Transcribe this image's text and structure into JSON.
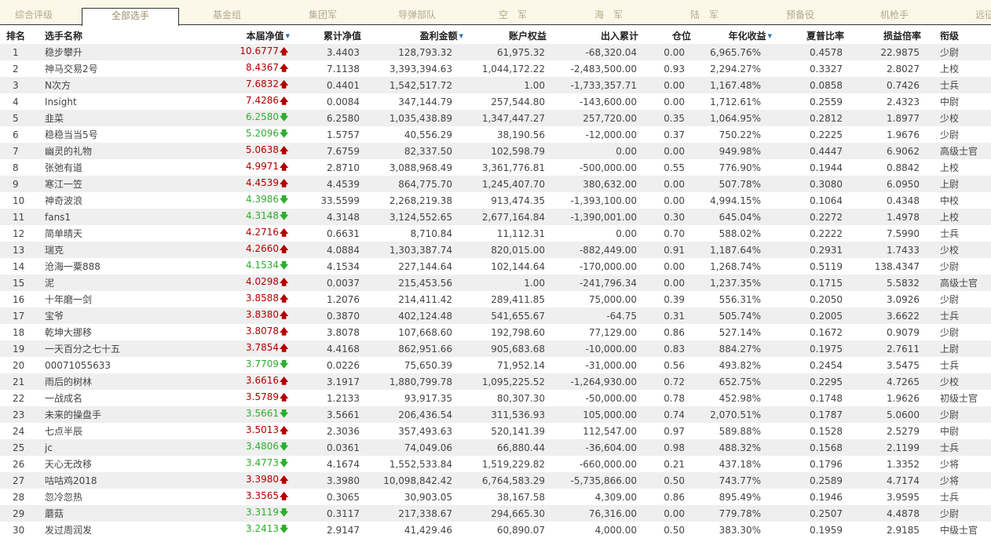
{
  "tabs": [
    {
      "label": "综合评级",
      "active": false
    },
    {
      "label": "全部选手",
      "active": true
    },
    {
      "label": "基金组",
      "active": false
    },
    {
      "label": "集团军",
      "active": false
    },
    {
      "label": "导弹部队",
      "active": false
    },
    {
      "label": "空　军",
      "active": false
    },
    {
      "label": "海　军",
      "active": false
    },
    {
      "label": "陆　军",
      "active": false
    },
    {
      "label": "预备役",
      "active": false
    },
    {
      "label": "机枪手",
      "active": false
    },
    {
      "label": "远征",
      "active": false
    }
  ],
  "columns": [
    {
      "label": "排名",
      "sortable": false
    },
    {
      "label": "选手名称",
      "sortable": false
    },
    {
      "label": "本届净值",
      "sortable": true
    },
    {
      "label": "累计净值",
      "sortable": false
    },
    {
      "label": "盈利金额",
      "sortable": true
    },
    {
      "label": "账户权益",
      "sortable": false
    },
    {
      "label": "出入累计",
      "sortable": false
    },
    {
      "label": "仓位",
      "sortable": false
    },
    {
      "label": "年化收益",
      "sortable": true
    },
    {
      "label": "夏普比率",
      "sortable": false
    },
    {
      "label": "损益倍率",
      "sortable": false
    },
    {
      "label": "衔级",
      "sortable": false
    }
  ],
  "icons": {
    "sort": "sort-down-icon",
    "up": "arrow-up-icon",
    "down": "arrow-down-icon",
    "up_glyph": "🡅",
    "down_glyph": "🡇",
    "sort_glyph": "▼"
  },
  "colors": {
    "up": "#b30000",
    "down": "#2eae2e",
    "sort": "#2a6fb8"
  },
  "rows": [
    {
      "rank": "1",
      "name": "稳步攀升",
      "nav": "10.6777",
      "trend": "up",
      "cum_nav": "3.4403",
      "profit": "128,793.32",
      "equity": "61,975.32",
      "flow": "-68,320.04",
      "position": "0.00",
      "annual": "6,965.76%",
      "sharpe": "0.4578",
      "pl_ratio": "22.9875",
      "grade": "少尉"
    },
    {
      "rank": "2",
      "name": "神马交易2号",
      "nav": "8.4367",
      "trend": "up",
      "cum_nav": "7.1138",
      "profit": "3,393,394.63",
      "equity": "1,044,172.22",
      "flow": "-2,483,500.00",
      "position": "0.93",
      "annual": "2,294.27%",
      "sharpe": "0.3327",
      "pl_ratio": "2.8027",
      "grade": "上校"
    },
    {
      "rank": "3",
      "name": "N次方",
      "nav": "7.6832",
      "trend": "up",
      "cum_nav": "0.4401",
      "profit": "1,542,517.72",
      "equity": "1.00",
      "flow": "-1,733,357.71",
      "position": "0.00",
      "annual": "1,167.48%",
      "sharpe": "0.0858",
      "pl_ratio": "0.7426",
      "grade": "士兵"
    },
    {
      "rank": "4",
      "name": "Insight",
      "nav": "7.4286",
      "trend": "up",
      "cum_nav": "0.0084",
      "profit": "347,144.79",
      "equity": "257,544.80",
      "flow": "-143,600.00",
      "position": "0.00",
      "annual": "1,712.61%",
      "sharpe": "0.2559",
      "pl_ratio": "2.4323",
      "grade": "中尉"
    },
    {
      "rank": "5",
      "name": "韭菜",
      "nav": "6.2580",
      "trend": "down",
      "cum_nav": "6.2580",
      "profit": "1,035,438.89",
      "equity": "1,347,447.27",
      "flow": "257,720.00",
      "position": "0.35",
      "annual": "1,064.95%",
      "sharpe": "0.2812",
      "pl_ratio": "1.8977",
      "grade": "少校"
    },
    {
      "rank": "6",
      "name": "稳稳当当5号",
      "nav": "5.2096",
      "trend": "down",
      "cum_nav": "1.5757",
      "profit": "40,556.29",
      "equity": "38,190.56",
      "flow": "-12,000.00",
      "position": "0.37",
      "annual": "750.22%",
      "sharpe": "0.2225",
      "pl_ratio": "1.9676",
      "grade": "少尉"
    },
    {
      "rank": "7",
      "name": "幽灵的礼物",
      "nav": "5.0638",
      "trend": "up",
      "cum_nav": "7.6759",
      "profit": "82,337.50",
      "equity": "102,598.79",
      "flow": "0.00",
      "position": "0.00",
      "annual": "949.98%",
      "sharpe": "0.4447",
      "pl_ratio": "6.9062",
      "grade": "高级士官"
    },
    {
      "rank": "8",
      "name": "张弛有道",
      "nav": "4.9971",
      "trend": "up",
      "cum_nav": "2.8710",
      "profit": "3,088,968.49",
      "equity": "3,361,776.81",
      "flow": "-500,000.00",
      "position": "0.55",
      "annual": "776.90%",
      "sharpe": "0.1944",
      "pl_ratio": "0.8842",
      "grade": "上校"
    },
    {
      "rank": "9",
      "name": "寒江一笠",
      "nav": "4.4539",
      "trend": "up",
      "cum_nav": "4.4539",
      "profit": "864,775.70",
      "equity": "1,245,407.70",
      "flow": "380,632.00",
      "position": "0.00",
      "annual": "507.78%",
      "sharpe": "0.3080",
      "pl_ratio": "6.0950",
      "grade": "上尉"
    },
    {
      "rank": "10",
      "name": "神奇波浪",
      "nav": "4.3986",
      "trend": "down",
      "cum_nav": "33.5599",
      "profit": "2,268,219.38",
      "equity": "913,474.35",
      "flow": "-1,393,100.00",
      "position": "0.00",
      "annual": "4,994.15%",
      "sharpe": "0.1064",
      "pl_ratio": "0.4348",
      "grade": "中校"
    },
    {
      "rank": "11",
      "name": "fans1",
      "nav": "4.3148",
      "trend": "down",
      "cum_nav": "4.3148",
      "profit": "3,124,552.65",
      "equity": "2,677,164.84",
      "flow": "-1,390,001.00",
      "position": "0.30",
      "annual": "645.04%",
      "sharpe": "0.2272",
      "pl_ratio": "1.4978",
      "grade": "上校"
    },
    {
      "rank": "12",
      "name": "简单晴天",
      "nav": "4.2716",
      "trend": "up",
      "cum_nav": "0.6631",
      "profit": "8,710.84",
      "equity": "11,112.31",
      "flow": "0.00",
      "position": "0.70",
      "annual": "588.02%",
      "sharpe": "0.2222",
      "pl_ratio": "7.5990",
      "grade": "士兵"
    },
    {
      "rank": "13",
      "name": "瑞克",
      "nav": "4.2660",
      "trend": "up",
      "cum_nav": "4.0884",
      "profit": "1,303,387.74",
      "equity": "820,015.00",
      "flow": "-882,449.00",
      "position": "0.91",
      "annual": "1,187.64%",
      "sharpe": "0.2931",
      "pl_ratio": "1.7433",
      "grade": "少校"
    },
    {
      "rank": "14",
      "name": "沧海一粟888",
      "nav": "4.1534",
      "trend": "down",
      "cum_nav": "4.1534",
      "profit": "227,144.64",
      "equity": "102,144.64",
      "flow": "-170,000.00",
      "position": "0.00",
      "annual": "1,268.74%",
      "sharpe": "0.5119",
      "pl_ratio": "138.4347",
      "grade": "少尉"
    },
    {
      "rank": "15",
      "name": "泥",
      "nav": "4.0298",
      "trend": "up",
      "cum_nav": "0.0037",
      "profit": "215,453.56",
      "equity": "1.00",
      "flow": "-241,796.34",
      "position": "0.00",
      "annual": "1,237.35%",
      "sharpe": "0.1715",
      "pl_ratio": "5.5832",
      "grade": "高级士官"
    },
    {
      "rank": "16",
      "name": "十年磨一剑",
      "nav": "3.8588",
      "trend": "up",
      "cum_nav": "1.2076",
      "profit": "214,411.42",
      "equity": "289,411.85",
      "flow": "75,000.00",
      "position": "0.39",
      "annual": "556.31%",
      "sharpe": "0.2050",
      "pl_ratio": "3.0926",
      "grade": "少尉"
    },
    {
      "rank": "17",
      "name": "宝爷",
      "nav": "3.8380",
      "trend": "up",
      "cum_nav": "0.3870",
      "profit": "402,124.48",
      "equity": "541,655.67",
      "flow": "-64.75",
      "position": "0.31",
      "annual": "505.74%",
      "sharpe": "0.2005",
      "pl_ratio": "3.6622",
      "grade": "士兵"
    },
    {
      "rank": "18",
      "name": "乾坤大挪移",
      "nav": "3.8078",
      "trend": "up",
      "cum_nav": "3.8078",
      "profit": "107,668.60",
      "equity": "192,798.60",
      "flow": "77,129.00",
      "position": "0.86",
      "annual": "527.14%",
      "sharpe": "0.1672",
      "pl_ratio": "0.9079",
      "grade": "少尉"
    },
    {
      "rank": "19",
      "name": "一天百分之七十五",
      "nav": "3.7854",
      "trend": "up",
      "cum_nav": "4.4168",
      "profit": "862,951.66",
      "equity": "905,683.68",
      "flow": "-10,000.00",
      "position": "0.83",
      "annual": "884.27%",
      "sharpe": "0.1975",
      "pl_ratio": "2.7611",
      "grade": "上尉"
    },
    {
      "rank": "20",
      "name": "00071055633",
      "nav": "3.7709",
      "trend": "down",
      "cum_nav": "0.0226",
      "profit": "75,650.39",
      "equity": "71,952.14",
      "flow": "-31,000.00",
      "position": "0.56",
      "annual": "493.82%",
      "sharpe": "0.2454",
      "pl_ratio": "3.5475",
      "grade": "士兵"
    },
    {
      "rank": "21",
      "name": "雨后的树林",
      "nav": "3.6616",
      "trend": "up",
      "cum_nav": "3.1917",
      "profit": "1,880,799.78",
      "equity": "1,095,225.52",
      "flow": "-1,264,930.00",
      "position": "0.72",
      "annual": "652.75%",
      "sharpe": "0.2295",
      "pl_ratio": "4.7265",
      "grade": "少校"
    },
    {
      "rank": "22",
      "name": "一战成名",
      "nav": "3.5789",
      "trend": "up",
      "cum_nav": "1.2133",
      "profit": "93,917.35",
      "equity": "80,307.30",
      "flow": "-50,000.00",
      "position": "0.78",
      "annual": "452.98%",
      "sharpe": "0.1748",
      "pl_ratio": "1.9626",
      "grade": "初级士官"
    },
    {
      "rank": "23",
      "name": "未来的操盘手",
      "nav": "3.5661",
      "trend": "down",
      "cum_nav": "3.5661",
      "profit": "206,436.54",
      "equity": "311,536.93",
      "flow": "105,000.00",
      "position": "0.74",
      "annual": "2,070.51%",
      "sharpe": "0.1787",
      "pl_ratio": "5.0600",
      "grade": "少尉"
    },
    {
      "rank": "24",
      "name": "七点半辰",
      "nav": "3.5013",
      "trend": "up",
      "cum_nav": "2.3036",
      "profit": "357,493.63",
      "equity": "520,141.39",
      "flow": "112,547.00",
      "position": "0.97",
      "annual": "589.88%",
      "sharpe": "0.1528",
      "pl_ratio": "2.5279",
      "grade": "中尉"
    },
    {
      "rank": "25",
      "name": "jc",
      "nav": "3.4806",
      "trend": "down",
      "cum_nav": "0.0361",
      "profit": "74,049.06",
      "equity": "66,880.44",
      "flow": "-36,604.00",
      "position": "0.98",
      "annual": "488.32%",
      "sharpe": "0.1568",
      "pl_ratio": "2.1199",
      "grade": "士兵"
    },
    {
      "rank": "26",
      "name": "天心无改移",
      "nav": "3.4773",
      "trend": "down",
      "cum_nav": "4.1674",
      "profit": "1,552,533.84",
      "equity": "1,519,229.82",
      "flow": "-660,000.00",
      "position": "0.21",
      "annual": "437.18%",
      "sharpe": "0.1796",
      "pl_ratio": "1.3352",
      "grade": "少将"
    },
    {
      "rank": "27",
      "name": "咕咕鸡2018",
      "nav": "3.3980",
      "trend": "up",
      "cum_nav": "3.3980",
      "profit": "10,098,842.42",
      "equity": "6,764,583.29",
      "flow": "-5,735,866.00",
      "position": "0.50",
      "annual": "743.77%",
      "sharpe": "0.2589",
      "pl_ratio": "4.7174",
      "grade": "少将"
    },
    {
      "rank": "28",
      "name": "忽冷忽热",
      "nav": "3.3565",
      "trend": "up",
      "cum_nav": "0.3065",
      "profit": "30,903.05",
      "equity": "38,167.58",
      "flow": "4,309.00",
      "position": "0.86",
      "annual": "895.49%",
      "sharpe": "0.1946",
      "pl_ratio": "3.9595",
      "grade": "士兵"
    },
    {
      "rank": "29",
      "name": "蘑菇",
      "nav": "3.3119",
      "trend": "down",
      "cum_nav": "0.3117",
      "profit": "217,338.67",
      "equity": "294,665.30",
      "flow": "76,316.00",
      "position": "0.00",
      "annual": "779.78%",
      "sharpe": "0.2507",
      "pl_ratio": "4.4878",
      "grade": "少尉"
    },
    {
      "rank": "30",
      "name": "发过周润发",
      "nav": "3.2413",
      "trend": "down",
      "cum_nav": "2.9147",
      "profit": "41,429.46",
      "equity": "60,890.07",
      "flow": "4,000.00",
      "position": "0.50",
      "annual": "383.30%",
      "sharpe": "0.1959",
      "pl_ratio": "2.9185",
      "grade": "中级士官"
    }
  ]
}
